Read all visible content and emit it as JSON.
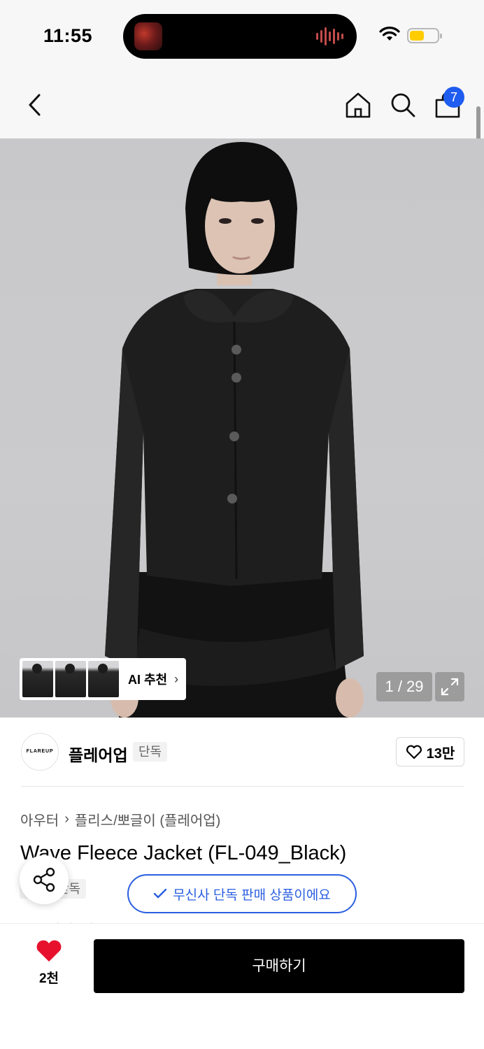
{
  "status_bar": {
    "time": "11:55",
    "battery_color": "#ffcc00"
  },
  "nav": {
    "cart_count": "7"
  },
  "hero": {
    "ai_recommend_label": "AI 추천",
    "page_counter": "1 / 29"
  },
  "brand": {
    "logo_text": "FLAREUP",
    "name": "플레어업",
    "tag": "단독",
    "like_count": "13만"
  },
  "product": {
    "breadcrumb": [
      "아우터",
      "플리스/뽀글이 (플레어업)"
    ],
    "title": "Wave Fleece Jacket (FL-049_Black)",
    "exclusive_tag": "단독",
    "exclusive_pill": "무신사 단독 판매 상품이에요"
  },
  "bottom_bar": {
    "heart_count": "2천",
    "buy_label": "구매하기",
    "heart_color": "#e8112d"
  }
}
